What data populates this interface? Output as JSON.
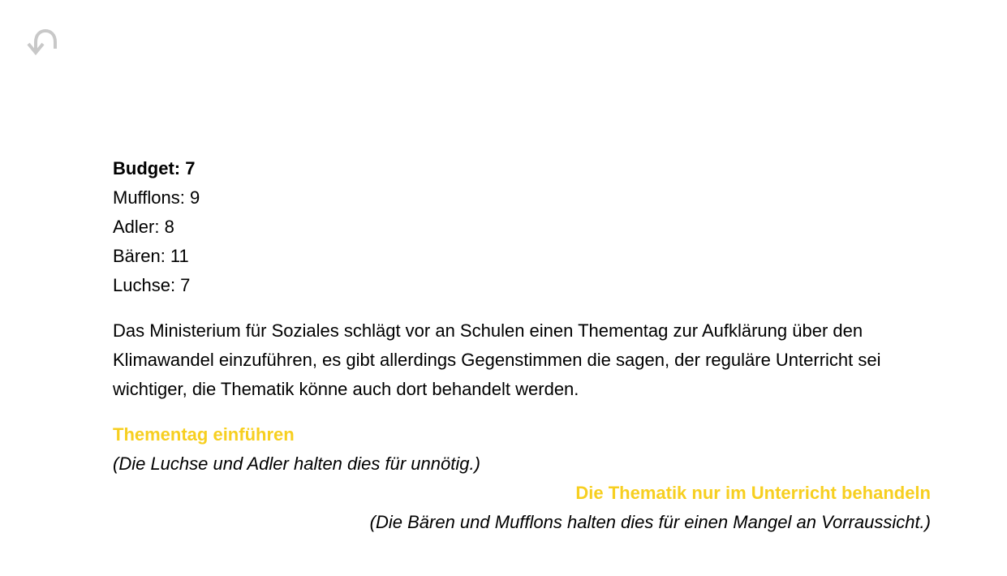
{
  "navigation": {
    "back_icon": "undo-arrow-icon",
    "icon_color": "#c8c8c8"
  },
  "stats": {
    "budget_label": "Budget: 7",
    "factions": [
      {
        "label": "Mufflons: 9"
      },
      {
        "label": "Adler: 8"
      },
      {
        "label": "Bären: 11"
      },
      {
        "label": "Luchse: 7"
      }
    ]
  },
  "scenario": {
    "description": "Das Ministerium für Soziales schlägt vor an Schulen einen Thementag zur Aufklärung über den Klimawandel einzuführen, es gibt allerdings Gegenstimmen die sagen, der reguläre Unterricht sei wichtiger, die Thematik könne auch dort behandelt werden."
  },
  "options": [
    {
      "title": "Thementag einführen",
      "note": "(Die Luchse und Adler halten dies für unnötig.)",
      "align": "left"
    },
    {
      "title": "Die Thematik nur im Unterricht behandeln",
      "note": "(Die Bären und Mufflons halten dies für einen Mangel an Vorraussicht.)",
      "align": "right"
    }
  ],
  "colors": {
    "option_accent": "#f7cf20",
    "text": "#000000",
    "background": "#ffffff"
  }
}
